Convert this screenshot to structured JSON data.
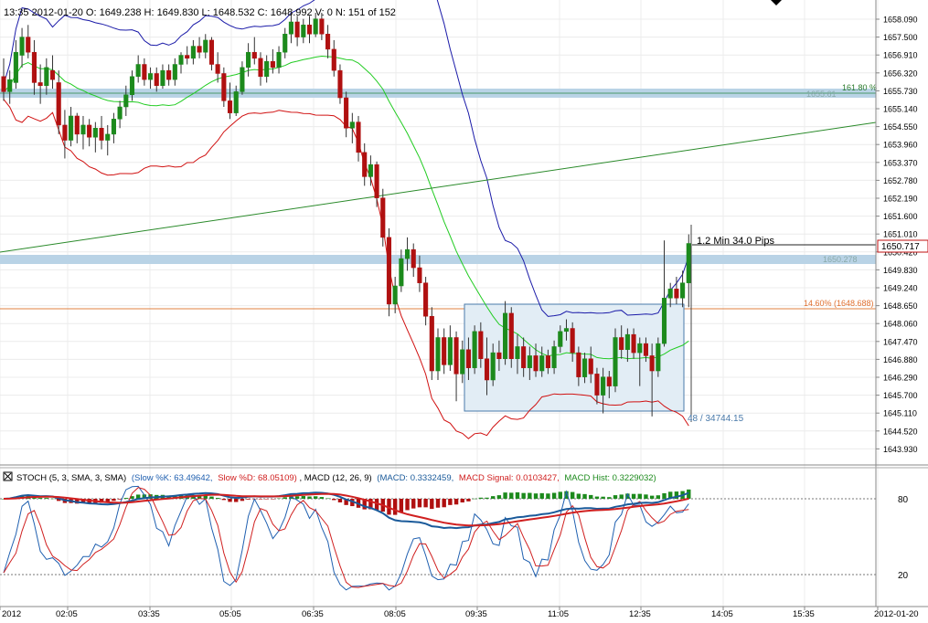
{
  "header": {
    "info": "13:35 2012-01-20  O: 1649.238  H: 1649.830  L: 1648.532  C: 1648.992  V: 0  N: 151 of 152"
  },
  "price_axis": {
    "labels": [
      "1658.090",
      "1657.500",
      "1656.910",
      "1656.320",
      "1655.730",
      "1655.140",
      "1654.550",
      "1653.960",
      "1653.370",
      "1652.780",
      "1652.190",
      "1651.600",
      "1651.010",
      "1650.420",
      "1649.830",
      "1649.240",
      "1648.650",
      "1648.060",
      "1647.470",
      "1646.880",
      "1646.290",
      "1645.700",
      "1645.110",
      "1644.520",
      "1643.930"
    ],
    "current_price": "1650.717"
  },
  "time_axis": {
    "labels": [
      "2012",
      "02:05",
      "03:35",
      "05:05",
      "06:35",
      "08:05",
      "09:35",
      "11:05",
      "12:35",
      "14:05",
      "15:35",
      "2012-01-20"
    ]
  },
  "annotations": {
    "fib_high_label": "161.80 %",
    "fib_high_value": "1655.61",
    "fib_mid_label": "1650.278",
    "fib_low_label": "14.60% (1648.688)",
    "measure_label": "1.2 Min 34.0 Pips",
    "box_label": "48 / 34744.15"
  },
  "indicator": {
    "legend_prefix": "STOCH (5, 3, SMA, 3, SMA)",
    "slowk": "(Slow %K: 63.49642,",
    "slowd": "Slow %D: 68.05109)",
    "macd_name": ", MACD (12, 26, 9)",
    "macd_val": "(MACD: 0.3332459,",
    "macd_signal": "MACD Signal: 0.0103427,",
    "macd_hist": "MACD Hist: 0.3229032)",
    "level_80": "80",
    "level_20": "20"
  },
  "colors": {
    "up": "#1c8a1c",
    "down": "#b01010",
    "upper_band": "#1a1aa8",
    "lower_band": "#d01010",
    "mid_band": "#22cc22",
    "trend": "#2a8a2a",
    "zone": "#b9d3e6",
    "fib_orange": "#e07030",
    "box": "#4a7aaa",
    "stoch_k": "#2060b0",
    "stoch_d": "#d02020",
    "macd": "#1a5a9a"
  },
  "chart_data": {
    "type": "candlestick",
    "symbol_date": "2012-01-20",
    "ylim": [
      1643.6,
      1658.4
    ],
    "ohlc": [
      {
        "i": 0,
        "o": 1656.2,
        "h": 1656.8,
        "l": 1655.4,
        "c": 1655.7
      },
      {
        "i": 1,
        "o": 1655.7,
        "h": 1656.4,
        "l": 1655.3,
        "c": 1656.1
      },
      {
        "i": 2,
        "o": 1656.0,
        "h": 1657.4,
        "l": 1655.8,
        "c": 1657.0
      },
      {
        "i": 3,
        "o": 1656.9,
        "h": 1657.8,
        "l": 1656.5,
        "c": 1657.5
      },
      {
        "i": 4,
        "o": 1657.5,
        "h": 1657.9,
        "l": 1656.8,
        "c": 1657.0
      },
      {
        "i": 5,
        "o": 1657.0,
        "h": 1657.4,
        "l": 1655.6,
        "c": 1656.0
      },
      {
        "i": 6,
        "o": 1656.0,
        "h": 1656.6,
        "l": 1655.3,
        "c": 1655.9
      },
      {
        "i": 7,
        "o": 1655.9,
        "h": 1656.8,
        "l": 1655.6,
        "c": 1656.5
      },
      {
        "i": 8,
        "o": 1656.4,
        "h": 1656.9,
        "l": 1655.8,
        "c": 1656.1
      },
      {
        "i": 9,
        "o": 1656.0,
        "h": 1656.4,
        "l": 1654.3,
        "c": 1654.6
      },
      {
        "i": 10,
        "o": 1654.6,
        "h": 1655.1,
        "l": 1653.5,
        "c": 1654.1
      },
      {
        "i": 11,
        "o": 1654.1,
        "h": 1655.2,
        "l": 1653.9,
        "c": 1654.9
      },
      {
        "i": 12,
        "o": 1654.9,
        "h": 1655.0,
        "l": 1654.0,
        "c": 1654.3
      },
      {
        "i": 13,
        "o": 1654.3,
        "h": 1654.9,
        "l": 1653.8,
        "c": 1654.6
      },
      {
        "i": 14,
        "o": 1654.6,
        "h": 1654.8,
        "l": 1653.9,
        "c": 1654.2
      },
      {
        "i": 15,
        "o": 1654.2,
        "h": 1654.7,
        "l": 1653.7,
        "c": 1654.5
      },
      {
        "i": 16,
        "o": 1654.5,
        "h": 1654.9,
        "l": 1653.8,
        "c": 1654.1
      },
      {
        "i": 17,
        "o": 1654.1,
        "h": 1654.6,
        "l": 1653.6,
        "c": 1654.3
      },
      {
        "i": 18,
        "o": 1654.3,
        "h": 1655.0,
        "l": 1654.0,
        "c": 1654.8
      },
      {
        "i": 19,
        "o": 1654.8,
        "h": 1655.4,
        "l": 1654.5,
        "c": 1655.2
      },
      {
        "i": 20,
        "o": 1655.2,
        "h": 1655.9,
        "l": 1654.9,
        "c": 1655.6
      },
      {
        "i": 21,
        "o": 1655.6,
        "h": 1656.4,
        "l": 1655.4,
        "c": 1656.2
      },
      {
        "i": 22,
        "o": 1656.2,
        "h": 1656.9,
        "l": 1656.0,
        "c": 1656.6
      },
      {
        "i": 23,
        "o": 1656.6,
        "h": 1656.8,
        "l": 1655.9,
        "c": 1656.1
      },
      {
        "i": 24,
        "o": 1656.1,
        "h": 1656.5,
        "l": 1655.8,
        "c": 1656.3
      },
      {
        "i": 25,
        "o": 1656.3,
        "h": 1656.5,
        "l": 1655.7,
        "c": 1655.9
      },
      {
        "i": 26,
        "o": 1655.9,
        "h": 1656.6,
        "l": 1655.8,
        "c": 1656.4
      },
      {
        "i": 27,
        "o": 1656.4,
        "h": 1656.6,
        "l": 1655.9,
        "c": 1656.1
      },
      {
        "i": 28,
        "o": 1656.1,
        "h": 1656.8,
        "l": 1655.9,
        "c": 1656.6
      },
      {
        "i": 29,
        "o": 1656.6,
        "h": 1657.0,
        "l": 1656.3,
        "c": 1656.9
      },
      {
        "i": 30,
        "o": 1656.9,
        "h": 1657.2,
        "l": 1656.6,
        "c": 1656.8
      },
      {
        "i": 31,
        "o": 1656.8,
        "h": 1657.4,
        "l": 1656.6,
        "c": 1657.2
      },
      {
        "i": 32,
        "o": 1657.2,
        "h": 1657.5,
        "l": 1656.8,
        "c": 1657.0
      },
      {
        "i": 33,
        "o": 1657.0,
        "h": 1657.6,
        "l": 1656.8,
        "c": 1657.4
      },
      {
        "i": 34,
        "o": 1657.4,
        "h": 1657.5,
        "l": 1656.4,
        "c": 1656.6
      },
      {
        "i": 35,
        "o": 1656.6,
        "h": 1657.0,
        "l": 1656.0,
        "c": 1656.3
      },
      {
        "i": 36,
        "o": 1656.3,
        "h": 1656.5,
        "l": 1655.2,
        "c": 1655.4
      },
      {
        "i": 37,
        "o": 1655.4,
        "h": 1656.0,
        "l": 1654.8,
        "c": 1655.0
      },
      {
        "i": 38,
        "o": 1655.0,
        "h": 1655.9,
        "l": 1654.9,
        "c": 1655.7
      },
      {
        "i": 39,
        "o": 1655.7,
        "h": 1656.7,
        "l": 1655.6,
        "c": 1656.5
      },
      {
        "i": 40,
        "o": 1656.5,
        "h": 1657.3,
        "l": 1656.2,
        "c": 1657.0
      },
      {
        "i": 41,
        "o": 1657.0,
        "h": 1657.5,
        "l": 1656.6,
        "c": 1656.8
      },
      {
        "i": 42,
        "o": 1656.8,
        "h": 1657.0,
        "l": 1655.9,
        "c": 1656.2
      },
      {
        "i": 43,
        "o": 1656.2,
        "h": 1656.9,
        "l": 1656.0,
        "c": 1656.7
      },
      {
        "i": 44,
        "o": 1656.7,
        "h": 1657.1,
        "l": 1656.3,
        "c": 1656.5
      },
      {
        "i": 45,
        "o": 1656.5,
        "h": 1657.2,
        "l": 1656.3,
        "c": 1657.0
      },
      {
        "i": 46,
        "o": 1657.0,
        "h": 1657.8,
        "l": 1656.8,
        "c": 1657.6
      },
      {
        "i": 47,
        "o": 1657.6,
        "h": 1658.3,
        "l": 1657.3,
        "c": 1658.0
      },
      {
        "i": 48,
        "o": 1658.0,
        "h": 1658.2,
        "l": 1657.2,
        "c": 1657.5
      },
      {
        "i": 49,
        "o": 1657.5,
        "h": 1658.1,
        "l": 1657.3,
        "c": 1657.9
      },
      {
        "i": 50,
        "o": 1657.9,
        "h": 1658.2,
        "l": 1657.3,
        "c": 1657.6
      },
      {
        "i": 51,
        "o": 1657.6,
        "h": 1658.3,
        "l": 1657.5,
        "c": 1658.1
      },
      {
        "i": 52,
        "o": 1658.1,
        "h": 1658.3,
        "l": 1657.4,
        "c": 1657.6
      },
      {
        "i": 53,
        "o": 1657.6,
        "h": 1657.9,
        "l": 1656.8,
        "c": 1657.1
      },
      {
        "i": 54,
        "o": 1657.1,
        "h": 1657.4,
        "l": 1656.2,
        "c": 1656.4
      },
      {
        "i": 55,
        "o": 1656.4,
        "h": 1656.6,
        "l": 1655.3,
        "c": 1655.5
      },
      {
        "i": 56,
        "o": 1655.5,
        "h": 1655.7,
        "l": 1654.2,
        "c": 1654.5
      },
      {
        "i": 57,
        "o": 1654.5,
        "h": 1655.0,
        "l": 1654.0,
        "c": 1654.7
      },
      {
        "i": 58,
        "o": 1654.7,
        "h": 1654.9,
        "l": 1653.4,
        "c": 1653.7
      },
      {
        "i": 59,
        "o": 1653.7,
        "h": 1654.0,
        "l": 1652.6,
        "c": 1652.9
      },
      {
        "i": 60,
        "o": 1652.9,
        "h": 1653.6,
        "l": 1652.6,
        "c": 1653.3
      },
      {
        "i": 61,
        "o": 1653.3,
        "h": 1653.4,
        "l": 1651.9,
        "c": 1652.2
      },
      {
        "i": 62,
        "o": 1652.2,
        "h": 1652.5,
        "l": 1650.6,
        "c": 1650.9
      },
      {
        "i": 63,
        "o": 1650.9,
        "h": 1651.2,
        "l": 1648.3,
        "c": 1648.7
      },
      {
        "i": 64,
        "o": 1648.7,
        "h": 1649.6,
        "l": 1648.4,
        "c": 1649.3
      },
      {
        "i": 65,
        "o": 1649.3,
        "h": 1650.5,
        "l": 1649.1,
        "c": 1650.2
      },
      {
        "i": 66,
        "o": 1650.2,
        "h": 1650.9,
        "l": 1649.8,
        "c": 1650.5
      },
      {
        "i": 67,
        "o": 1650.5,
        "h": 1650.7,
        "l": 1649.6,
        "c": 1649.9
      },
      {
        "i": 68,
        "o": 1649.9,
        "h": 1650.3,
        "l": 1649.1,
        "c": 1649.4
      },
      {
        "i": 69,
        "o": 1649.4,
        "h": 1649.6,
        "l": 1648.0,
        "c": 1648.3
      },
      {
        "i": 70,
        "o": 1648.3,
        "h": 1648.6,
        "l": 1646.2,
        "c": 1646.5
      },
      {
        "i": 71,
        "o": 1646.5,
        "h": 1647.9,
        "l": 1646.2,
        "c": 1647.6
      },
      {
        "i": 72,
        "o": 1647.6,
        "h": 1647.9,
        "l": 1646.4,
        "c": 1646.7
      },
      {
        "i": 73,
        "o": 1646.7,
        "h": 1648.0,
        "l": 1646.5,
        "c": 1647.6
      },
      {
        "i": 74,
        "o": 1647.6,
        "h": 1647.8,
        "l": 1645.5,
        "c": 1646.4
      },
      {
        "i": 75,
        "o": 1646.4,
        "h": 1647.5,
        "l": 1646.1,
        "c": 1647.2
      },
      {
        "i": 76,
        "o": 1647.2,
        "h": 1647.6,
        "l": 1646.2,
        "c": 1646.6
      },
      {
        "i": 77,
        "o": 1646.6,
        "h": 1648.0,
        "l": 1646.4,
        "c": 1647.8
      },
      {
        "i": 78,
        "o": 1647.8,
        "h": 1648.1,
        "l": 1646.6,
        "c": 1646.9
      },
      {
        "i": 79,
        "o": 1646.9,
        "h": 1647.6,
        "l": 1645.7,
        "c": 1646.2
      },
      {
        "i": 80,
        "o": 1646.2,
        "h": 1647.4,
        "l": 1646.0,
        "c": 1647.1
      },
      {
        "i": 81,
        "o": 1647.1,
        "h": 1647.5,
        "l": 1646.5,
        "c": 1646.9
      },
      {
        "i": 82,
        "o": 1646.9,
        "h": 1648.8,
        "l": 1646.7,
        "c": 1648.4
      },
      {
        "i": 83,
        "o": 1648.4,
        "h": 1648.6,
        "l": 1646.6,
        "c": 1646.9
      },
      {
        "i": 84,
        "o": 1646.9,
        "h": 1647.7,
        "l": 1646.4,
        "c": 1647.3
      },
      {
        "i": 85,
        "o": 1647.3,
        "h": 1647.6,
        "l": 1646.3,
        "c": 1646.6
      },
      {
        "i": 86,
        "o": 1646.6,
        "h": 1647.3,
        "l": 1646.2,
        "c": 1647.0
      },
      {
        "i": 87,
        "o": 1647.0,
        "h": 1647.4,
        "l": 1646.3,
        "c": 1646.5
      },
      {
        "i": 88,
        "o": 1646.5,
        "h": 1647.3,
        "l": 1646.3,
        "c": 1647.0
      },
      {
        "i": 89,
        "o": 1647.0,
        "h": 1647.2,
        "l": 1646.4,
        "c": 1646.6
      },
      {
        "i": 90,
        "o": 1646.6,
        "h": 1647.5,
        "l": 1646.4,
        "c": 1647.3
      },
      {
        "i": 91,
        "o": 1647.3,
        "h": 1648.0,
        "l": 1647.1,
        "c": 1647.8
      },
      {
        "i": 92,
        "o": 1647.8,
        "h": 1648.2,
        "l": 1647.5,
        "c": 1647.9
      },
      {
        "i": 93,
        "o": 1647.9,
        "h": 1648.1,
        "l": 1646.8,
        "c": 1647.1
      },
      {
        "i": 94,
        "o": 1647.1,
        "h": 1647.3,
        "l": 1646.0,
        "c": 1646.3
      },
      {
        "i": 95,
        "o": 1646.3,
        "h": 1647.1,
        "l": 1646.1,
        "c": 1646.9
      },
      {
        "i": 96,
        "o": 1646.9,
        "h": 1647.3,
        "l": 1646.1,
        "c": 1646.4
      },
      {
        "i": 97,
        "o": 1646.4,
        "h": 1646.6,
        "l": 1645.4,
        "c": 1645.7
      },
      {
        "i": 98,
        "o": 1645.7,
        "h": 1646.6,
        "l": 1645.1,
        "c": 1646.3
      },
      {
        "i": 99,
        "o": 1646.3,
        "h": 1646.5,
        "l": 1645.6,
        "c": 1646.0
      },
      {
        "i": 100,
        "o": 1646.0,
        "h": 1647.9,
        "l": 1645.8,
        "c": 1647.6
      },
      {
        "i": 101,
        "o": 1647.6,
        "h": 1648.0,
        "l": 1646.9,
        "c": 1647.2
      },
      {
        "i": 102,
        "o": 1647.2,
        "h": 1647.9,
        "l": 1646.8,
        "c": 1647.7
      },
      {
        "i": 103,
        "o": 1647.7,
        "h": 1647.9,
        "l": 1646.9,
        "c": 1647.1
      },
      {
        "i": 104,
        "o": 1647.1,
        "h": 1647.6,
        "l": 1646.0,
        "c": 1647.4
      },
      {
        "i": 105,
        "o": 1647.4,
        "h": 1647.6,
        "l": 1646.8,
        "c": 1647.0
      },
      {
        "i": 106,
        "o": 1647.0,
        "h": 1647.4,
        "l": 1645.0,
        "c": 1646.5
      },
      {
        "i": 107,
        "o": 1646.5,
        "h": 1647.6,
        "l": 1646.3,
        "c": 1647.4
      },
      {
        "i": 108,
        "o": 1647.4,
        "h": 1650.8,
        "l": 1647.3,
        "c": 1648.9
      },
      {
        "i": 109,
        "o": 1648.9,
        "h": 1649.4,
        "l": 1648.6,
        "c": 1649.2
      },
      {
        "i": 110,
        "o": 1649.2,
        "h": 1649.6,
        "l": 1648.7,
        "c": 1648.9
      },
      {
        "i": 111,
        "o": 1648.9,
        "h": 1649.8,
        "l": 1648.6,
        "c": 1649.4
      },
      {
        "i": 112,
        "o": 1649.4,
        "h": 1651.0,
        "l": 1648.6,
        "c": 1650.7
      }
    ]
  }
}
